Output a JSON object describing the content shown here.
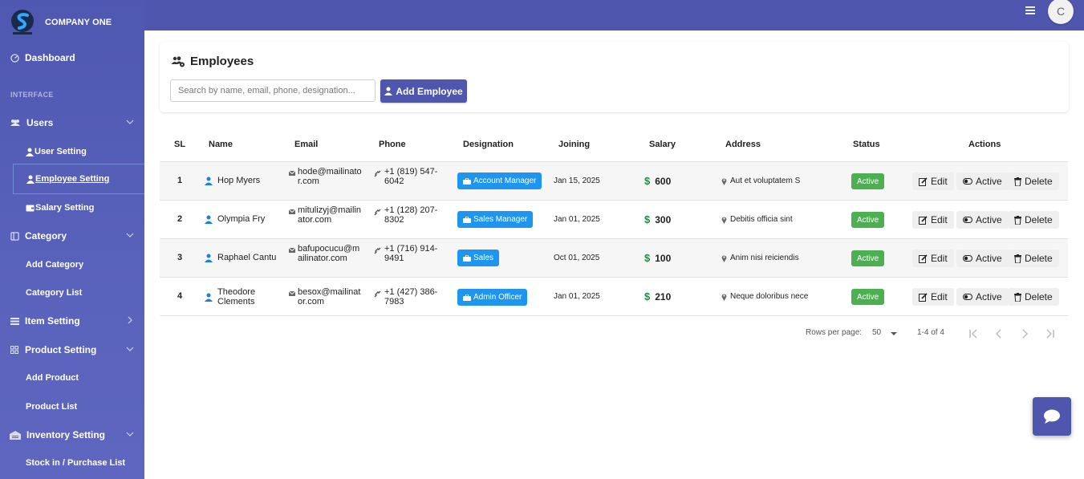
{
  "brand": {
    "name": "COMPANY ONE"
  },
  "sidebar": {
    "dashboard": "Dashboard",
    "section": "INTERFACE",
    "users": "Users",
    "user_setting": "User Setting",
    "employee_setting": "Employee Setting",
    "salary_setting": "Salary Setting",
    "category": "Category",
    "add_category": "Add Category",
    "category_list": "Category List",
    "item_setting": "Item Setting",
    "product_setting": "Product Setting",
    "add_product": "Add Product",
    "product_list": "Product List",
    "inventory_setting": "Inventory Setting",
    "stock_in": "Stock in / Purchase List"
  },
  "topbar": {
    "avatar_letter": "C"
  },
  "page": {
    "title": "Employees",
    "search_placeholder": "Search by name, email, phone, designation...",
    "add_button": "Add Employee"
  },
  "table": {
    "headers": {
      "sl": "SL",
      "name": "Name",
      "email": "Email",
      "phone": "Phone",
      "designation": "Designation",
      "joining": "Joining",
      "salary": "Salary",
      "address": "Address",
      "status": "Status",
      "actions": "Actions"
    },
    "currency": "$",
    "actions": {
      "edit": "Edit",
      "active": "Active",
      "delete": "Delete"
    },
    "rows": [
      {
        "sl": "1",
        "name": "Hop Myers",
        "email_l1": "hode@mailinato",
        "email_l2": "r.com",
        "phone_l1": "+1 (819) 547-",
        "phone_l2": "6042",
        "designation": "Account Manager",
        "joining": "Jan 15, 2025",
        "salary": "600",
        "address": "Aut et voluptatem S",
        "status": "Active"
      },
      {
        "sl": "2",
        "name": "Olympia Fry",
        "email_l1": "mitulizyj@mailin",
        "email_l2": "ator.com",
        "phone_l1": "+1 (128) 207-",
        "phone_l2": "8302",
        "designation": "Sales Manager",
        "joining": "Jan 01, 2025",
        "salary": "300",
        "address": "Debitis officia sint",
        "status": "Active"
      },
      {
        "sl": "3",
        "name": "Raphael Cantu",
        "email_l1": "bafupocucu@m",
        "email_l2": "ailinator.com",
        "phone_l1": "+1 (716) 914-",
        "phone_l2": "9491",
        "designation": "Sales",
        "joining": "Oct 01, 2025",
        "salary": "100",
        "address": "Anim nisi reiciendis",
        "status": "Active"
      },
      {
        "sl": "4",
        "name_l1": "Theodore",
        "name_l2": "Clements",
        "email_l1": "besox@mailinat",
        "email_l2": "or.com",
        "phone_l1": "+1 (427) 386-",
        "phone_l2": "7983",
        "designation": "Admin Officer",
        "joining": "Jan 01, 2025",
        "salary": "210",
        "address": "Neque doloribus nece",
        "status": "Active"
      }
    ]
  },
  "pagination": {
    "rows_per_page_label": "Rows per page:",
    "rows_per_page": "50",
    "range": "1-4 of 4"
  },
  "colors": {
    "primary": "#4f56ad",
    "info": "#1e96ef",
    "success": "#4caf50"
  }
}
